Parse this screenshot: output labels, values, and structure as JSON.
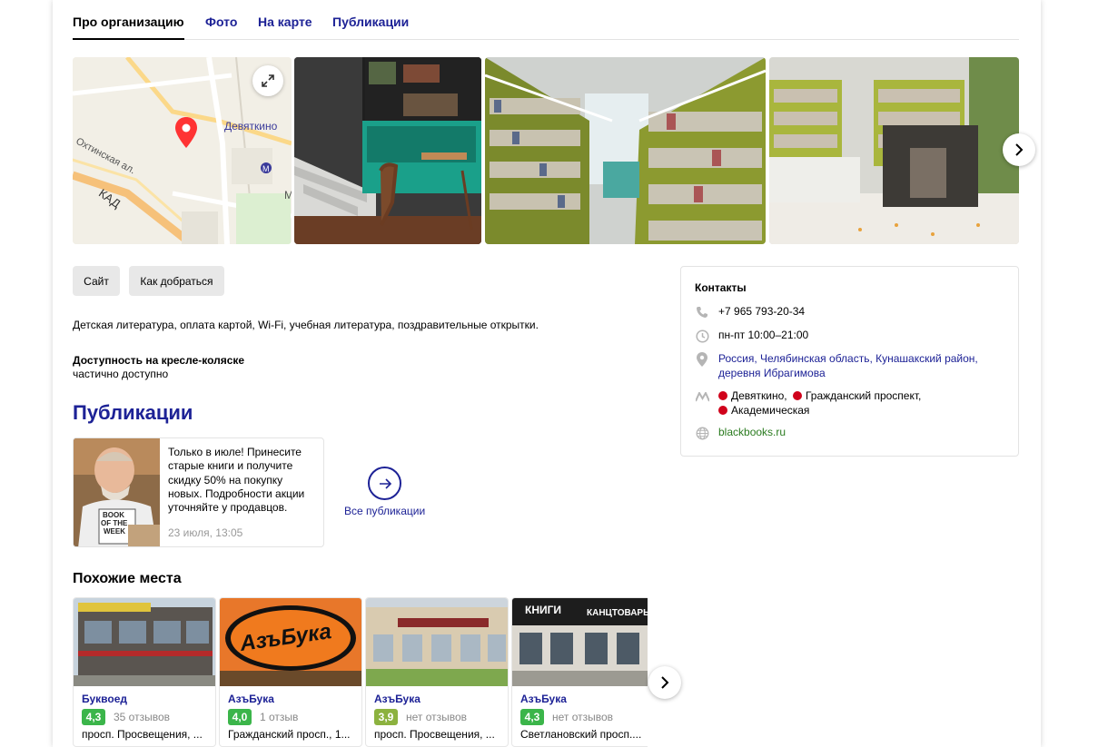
{
  "tabs": [
    {
      "label": "Про организацию",
      "active": true
    },
    {
      "label": "Фото",
      "active": false
    },
    {
      "label": "На карте",
      "active": false
    },
    {
      "label": "Публикации",
      "active": false
    }
  ],
  "map": {
    "station": "Девяткино",
    "street": "Охтинская ал.",
    "road": "КАД",
    "letter": "М"
  },
  "buttons": {
    "site": "Сайт",
    "route": "Как добраться"
  },
  "description": "Детская литература, оплата картой, Wi-Fi, учебная литература, поздравительные открытки.",
  "accessibility": {
    "title": "Доступность на кресле-коляске",
    "value": "частично доступно"
  },
  "publications": {
    "title": "Публикации",
    "card": {
      "text": "Только в июле! Принесите старые книги и получите скидку 50% на покупку новых. Подробности акции уточняйте у продавцов.",
      "date": "23 июля, 13:05",
      "shirt_text": [
        "BOOK",
        "OF THE",
        "WEEK"
      ]
    },
    "all_label": "Все публикации"
  },
  "similar": {
    "title": "Похожие места",
    "items": [
      {
        "name": "Буквоед",
        "rating": "4,3",
        "reviews": "35 отзывов",
        "address": "просп. Просвещения, ...",
        "rating_color": "#3bb54a"
      },
      {
        "name": "АзъБука",
        "rating": "4,0",
        "reviews": "1 отзыв",
        "address": "Гражданский просп., 1...",
        "rating_color": "#3bb54a",
        "logo": "АзъБука"
      },
      {
        "name": "АзъБука",
        "rating": "3,9",
        "reviews": "нет отзывов",
        "address": "просп. Просвещения, ...",
        "rating_color": "#8cb23f"
      },
      {
        "name": "АзъБука",
        "rating": "4,3",
        "reviews": "нет отзывов",
        "address": "Светлановский просп....",
        "rating_color": "#3bb54a",
        "sign1": "КНИГИ",
        "sign2": "КАНЦТОВАРЫ"
      }
    ]
  },
  "contacts": {
    "title": "Контакты",
    "phone": "+7 965 793-20-34",
    "hours": "пн-пт 10:00–21:00",
    "address_line1": "Россия, Челябинская область, Кунашакский район,",
    "address_line2": "деревня Ибрагимова",
    "metro": [
      "Девяткино,",
      "Гражданский проспект,",
      "Академическая"
    ],
    "website": "blackbooks.ru"
  },
  "colors": {
    "link": "#1d2296",
    "metro": "#d0021b",
    "website": "#2a7b1f"
  }
}
